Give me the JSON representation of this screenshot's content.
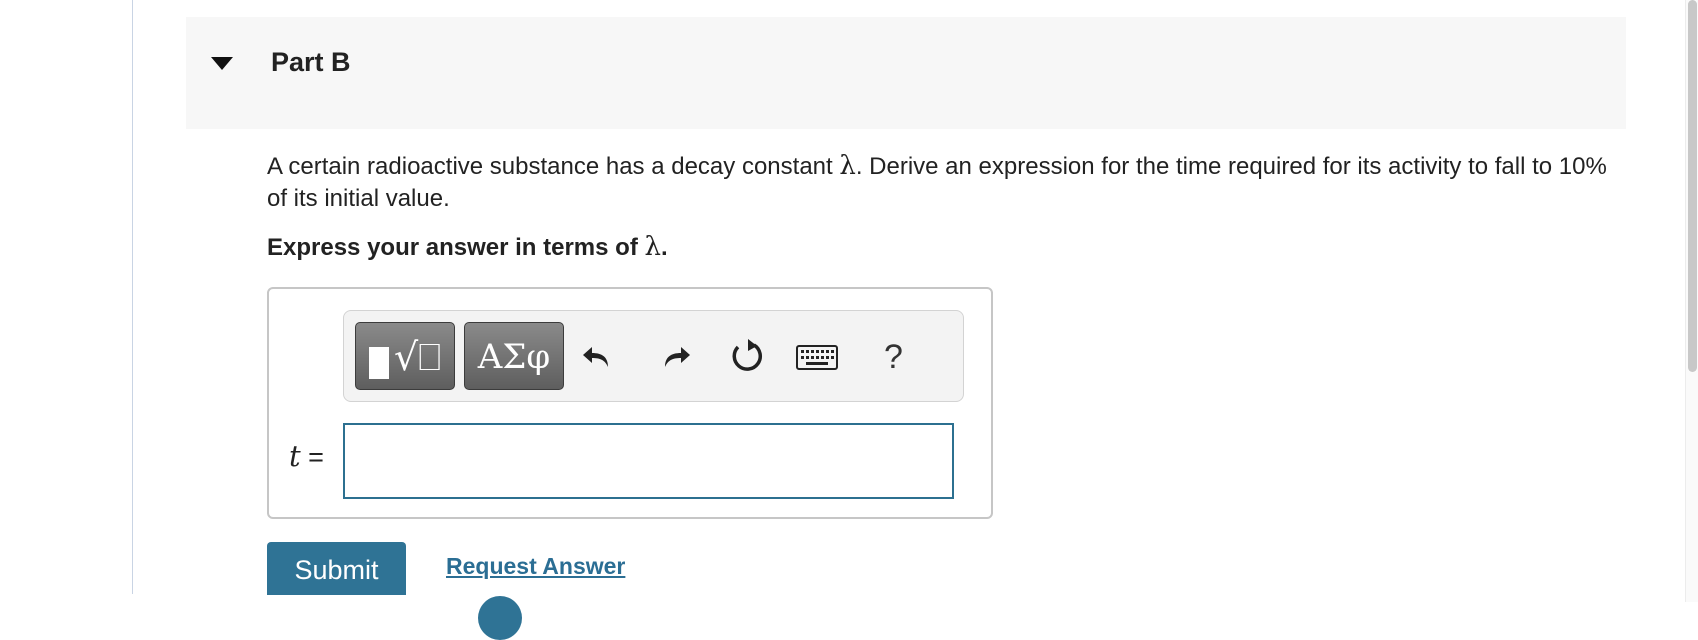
{
  "part": {
    "title": "Part B"
  },
  "question": {
    "prefix": "A certain radioactive substance has a decay constant ",
    "symbol": "λ",
    "suffix": ". Derive an expression for the time required for its activity to fall to 10% of its initial value."
  },
  "instruction": {
    "prefix": "Express your answer in terms of ",
    "symbol": "λ",
    "suffix": "."
  },
  "toolbar": {
    "templates_glyph": "√⎕",
    "symbols_label": "ΑΣφ",
    "help_label": "?"
  },
  "answer": {
    "variable": "t",
    "equals": "=",
    "value": ""
  },
  "actions": {
    "submit_label": "Submit",
    "request_label": "Request Answer"
  },
  "colors": {
    "accent": "#2f7395",
    "link": "#2b6e94",
    "input_border": "#2c7090",
    "header_bg": "#f7f7f7"
  }
}
